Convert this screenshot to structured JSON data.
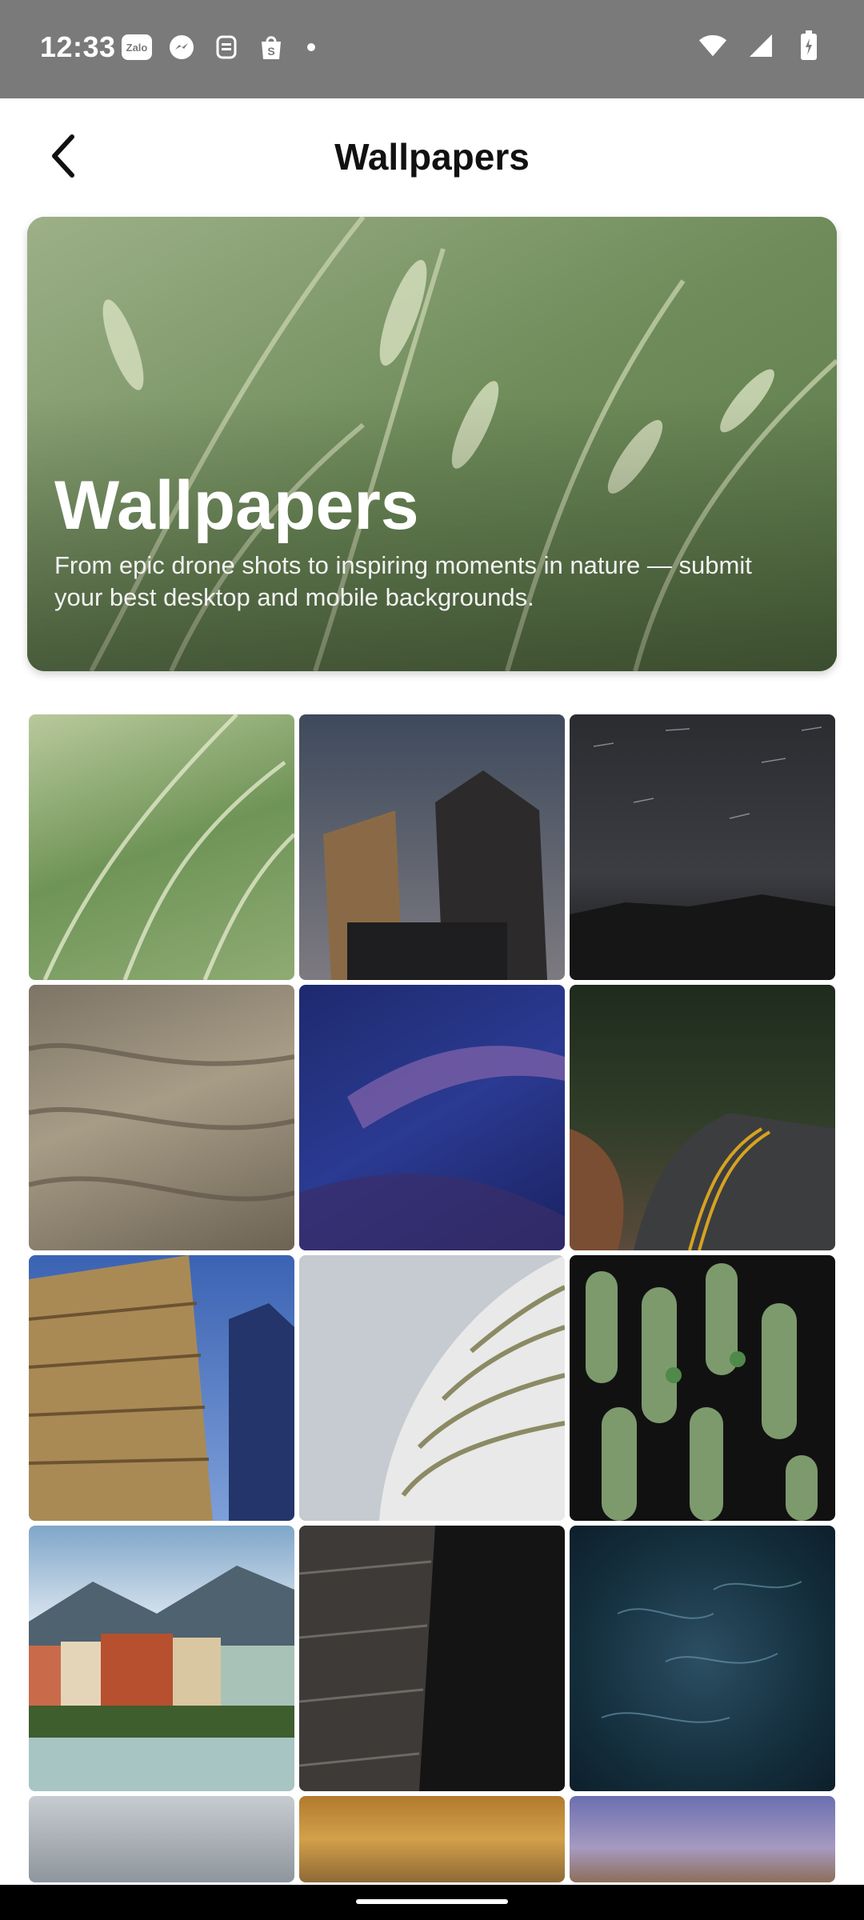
{
  "status_bar": {
    "time": "12:33",
    "left_icons": [
      "zalo-icon",
      "messenger-icon",
      "shield-icon",
      "shopee-icon"
    ],
    "right_icons": [
      "wifi-icon",
      "signal-icon",
      "battery-icon"
    ]
  },
  "header": {
    "title": "Wallpapers",
    "back_icon": "back-arrow-icon"
  },
  "hero": {
    "title": "Wallpapers",
    "description": "From epic drone shots to inspiring moments in nature — submit your best desktop and mobile backgrounds."
  },
  "grid": {
    "tiles": [
      {
        "subject": "wheat"
      },
      {
        "subject": "skyscrapers-dusk"
      },
      {
        "subject": "star-trails"
      },
      {
        "subject": "desert-hills"
      },
      {
        "subject": "blue-dunes"
      },
      {
        "subject": "forest-road"
      },
      {
        "subject": "golden-tower"
      },
      {
        "subject": "curved-facade"
      },
      {
        "subject": "cactus"
      },
      {
        "subject": "colorful-houses"
      },
      {
        "subject": "dark-building"
      },
      {
        "subject": "ocean"
      },
      {
        "subject": "clouds"
      },
      {
        "subject": "sunset"
      },
      {
        "subject": "twilight-castle"
      }
    ]
  }
}
